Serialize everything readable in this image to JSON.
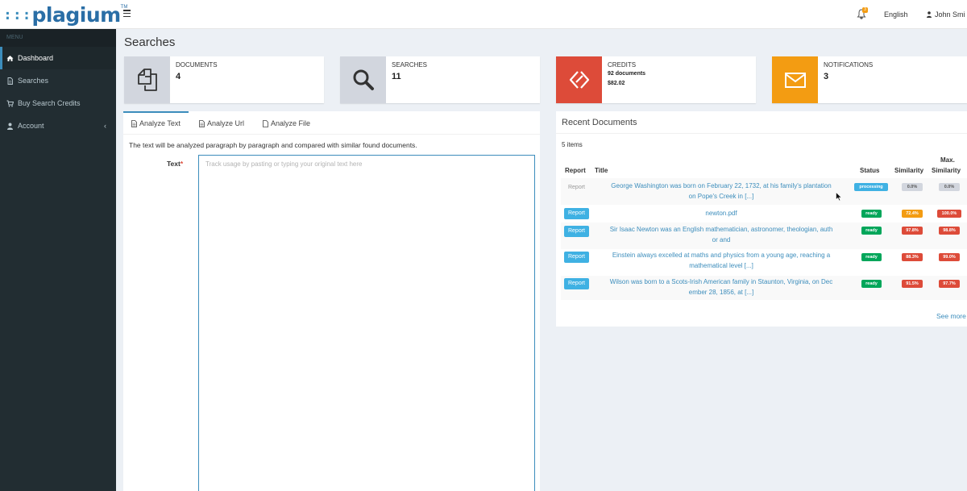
{
  "brand": {
    "dots": ":::",
    "name": "plagium",
    "tm": "TM"
  },
  "header": {
    "notification_count": "3",
    "language": "English",
    "user_name": "John Smi"
  },
  "sidebar": {
    "menu_header": "MENU",
    "items": [
      {
        "label": "Dashboard",
        "icon": "home-icon"
      },
      {
        "label": "Searches",
        "icon": "file-icon"
      },
      {
        "label": "Buy Search Credits",
        "icon": "cart-icon"
      },
      {
        "label": "Account",
        "icon": "user-icon",
        "caret": "‹"
      }
    ]
  },
  "page": {
    "title": "Searches"
  },
  "info_boxes": [
    {
      "label": "DOCUMENTS",
      "value": "4",
      "icon": "documents-icon",
      "color": "#d2d6de"
    },
    {
      "label": "SEARCHES",
      "value": "11",
      "icon": "search-icon",
      "color": "#d2d6de"
    },
    {
      "label": "CREDITS",
      "line1": "92 documents",
      "line2": "$82.02",
      "icon": "credits-icon",
      "color": "#dd4b39"
    },
    {
      "label": "NOTIFICATIONS",
      "value": "3",
      "icon": "envelope-icon",
      "color": "#f39c12"
    }
  ],
  "analyze": {
    "tabs": [
      "Analyze Text",
      "Analyze Url",
      "Analyze File"
    ],
    "description": "The text will be analyzed paragraph by paragraph and compared with similar found documents.",
    "text_label": "Text",
    "required_mark": "*",
    "placeholder": "Track usage by pasting or typing your original text here"
  },
  "recent": {
    "title": "Recent Documents",
    "count": "5 items",
    "columns": {
      "report": "Report",
      "title": "Title",
      "status": "Status",
      "similarity": "Similarity",
      "max_line1": "Max.",
      "max_line2": "Similarity"
    },
    "rows": [
      {
        "report": "Report",
        "title1": "George Washington was born on February 22, 1732, at his family's plantation",
        "title2": "on Pope's Creek in [...]",
        "status": "processing",
        "similarity": "0.0%",
        "max": "0.0%"
      },
      {
        "report": "Report",
        "title1": "newton.pdf",
        "title2": "",
        "status": "ready",
        "similarity": "72.4%",
        "max": "100.0%"
      },
      {
        "report": "Report",
        "title1": "Sir Isaac Newton was an English mathematician, astronomer, theologian, auth",
        "title2": "or and",
        "status": "ready",
        "similarity": "97.8%",
        "max": "98.8%"
      },
      {
        "report": "Report",
        "title1": "Einstein always excelled at maths and physics from a young age, reaching a",
        "title2": "mathematical level [...]",
        "status": "ready",
        "similarity": "88.3%",
        "max": "99.0%"
      },
      {
        "report": "Report",
        "title1": "Wilson was born to a Scots-Irish American family in Staunton, Virginia, on Dec",
        "title2": "ember 28, 1856, at [...]",
        "status": "ready",
        "similarity": "91.5%",
        "max": "97.7%"
      }
    ],
    "see_more": "See more"
  },
  "colors": {
    "accent": "#3c8dbc",
    "status_processing": "#3fb1e3",
    "status_ready": "#00a65a",
    "danger": "#dd4b39",
    "warning": "#f39c12",
    "neutral": "#d2d6de"
  }
}
